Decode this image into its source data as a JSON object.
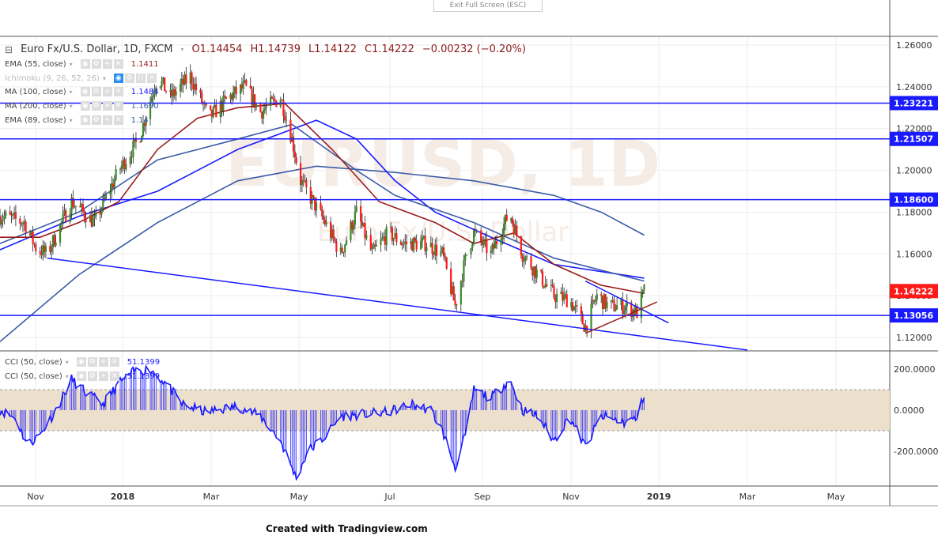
{
  "ui": {
    "exit_fullscreen": "Exit Full Screen (ESC)",
    "footer": "Created with Tradingview.com",
    "watermark": "EURUSD, 1D",
    "watermark2": "Euro Fx/U.S. Dollar"
  },
  "header": {
    "symbol": "Euro Fx/U.S. Dollar, 1D, FXCM",
    "open": "O1.14454",
    "high": "H1.14739",
    "low": "L1.14122",
    "close": "C1.14222",
    "change": "−0.00232 (−0.20%)"
  },
  "indicators": [
    {
      "label": "EMA (55, close)",
      "value": "1.1411",
      "color": "#9b1c1c"
    },
    {
      "label": "Ichimoku (9, 26, 52, 26)",
      "value": "",
      "color": "#bbbbbb"
    },
    {
      "label": "MA (100, close)",
      "value": "1.1484",
      "color": "#1a1aff"
    },
    {
      "label": "MA (200, close)",
      "value": "1.1690",
      "color": "#3a5ba8"
    },
    {
      "label": "EMA (89, close)",
      "value": "1.14",
      "color": "#3a5ba8"
    }
  ],
  "cci_legend": [
    {
      "label": "CCI (50, close)",
      "value": "51.1399"
    },
    {
      "label": "CCI (50, close)",
      "value": "51.1399"
    }
  ],
  "chart_data": [
    {
      "type": "candlestick",
      "title": "Euro Fx/U.S. Dollar, 1D, FXCM",
      "x_unit": "days since 2017-10-20",
      "x_ticks": [
        "Nov",
        "2018",
        "Mar",
        "May",
        "Jul",
        "Sep",
        "Nov",
        "2019",
        "Mar",
        "May"
      ],
      "y_ticks": [
        "1.26000",
        "1.24000",
        "1.22000",
        "1.20000",
        "1.18000",
        "1.16000",
        "1.14000",
        "1.12000"
      ],
      "ylim": [
        1.112,
        1.264
      ],
      "price_path": [
        [
          3,
          1.178
        ],
        [
          17,
          1.175
        ],
        [
          25,
          1.163
        ],
        [
          33,
          1.16
        ],
        [
          50,
          1.185
        ],
        [
          66,
          1.175
        ],
        [
          83,
          1.2
        ],
        [
          97,
          1.215
        ],
        [
          110,
          1.245
        ],
        [
          119,
          1.235
        ],
        [
          133,
          1.245
        ],
        [
          146,
          1.225
        ],
        [
          160,
          1.235
        ],
        [
          171,
          1.24
        ],
        [
          182,
          1.228
        ],
        [
          196,
          1.235
        ],
        [
          204,
          1.215
        ],
        [
          210,
          1.195
        ],
        [
          227,
          1.175
        ],
        [
          238,
          1.16
        ],
        [
          249,
          1.18
        ],
        [
          260,
          1.16
        ],
        [
          271,
          1.17
        ],
        [
          282,
          1.165
        ],
        [
          298,
          1.165
        ],
        [
          309,
          1.16
        ],
        [
          318,
          1.135
        ],
        [
          326,
          1.16
        ],
        [
          331,
          1.17
        ],
        [
          343,
          1.16
        ],
        [
          356,
          1.18
        ],
        [
          365,
          1.16
        ],
        [
          376,
          1.15
        ],
        [
          387,
          1.14
        ],
        [
          398,
          1.138
        ],
        [
          409,
          1.125
        ],
        [
          417,
          1.14
        ],
        [
          425,
          1.135
        ],
        [
          436,
          1.135
        ],
        [
          445,
          1.132
        ],
        [
          450,
          1.1422
        ]
      ],
      "moving_averages": [
        {
          "name": "MA 200",
          "color": "#3a5ba8",
          "points": [
            [
              0,
              1.118
            ],
            [
              55,
              1.15
            ],
            [
              110,
              1.175
            ],
            [
              166,
              1.195
            ],
            [
              221,
              1.202
            ],
            [
              276,
              1.199
            ],
            [
              331,
              1.195
            ],
            [
              387,
              1.188
            ],
            [
              420,
              1.18
            ],
            [
              450,
              1.169
            ]
          ]
        },
        {
          "name": "MA 100",
          "color": "#1a1aff",
          "points": [
            [
              0,
              1.162
            ],
            [
              55,
              1.178
            ],
            [
              110,
              1.19
            ],
            [
              166,
              1.21
            ],
            [
              221,
              1.224
            ],
            [
              249,
              1.215
            ],
            [
              276,
              1.195
            ],
            [
              304,
              1.18
            ],
            [
              343,
              1.168
            ],
            [
              387,
              1.155
            ],
            [
              450,
              1.1484
            ]
          ]
        },
        {
          "name": "EMA 89",
          "color": "#3a5ba8",
          "points": [
            [
              0,
              1.165
            ],
            [
              55,
              1.18
            ],
            [
              110,
              1.205
            ],
            [
              166,
              1.215
            ],
            [
              204,
              1.222
            ],
            [
              249,
              1.2
            ],
            [
              276,
              1.188
            ],
            [
              331,
              1.175
            ],
            [
              387,
              1.158
            ],
            [
              450,
              1.147
            ]
          ]
        },
        {
          "name": "EMA 55",
          "color": "#9b1c1c",
          "points": [
            [
              0,
              1.168
            ],
            [
              28,
              1.168
            ],
            [
              55,
              1.175
            ],
            [
              83,
              1.185
            ],
            [
              110,
              1.21
            ],
            [
              138,
              1.225
            ],
            [
              166,
              1.23
            ],
            [
              199,
              1.232
            ],
            [
              232,
              1.21
            ],
            [
              265,
              1.185
            ],
            [
              304,
              1.175
            ],
            [
              331,
              1.165
            ],
            [
              359,
              1.17
            ],
            [
              387,
              1.155
            ],
            [
              420,
              1.145
            ],
            [
              450,
              1.1411
            ]
          ]
        }
      ],
      "horizontal_levels": [
        {
          "value": 1.23221,
          "label": "1.23221"
        },
        {
          "value": 1.21507,
          "label": "1.21507"
        },
        {
          "value": 1.186,
          "label": "1.18600"
        },
        {
          "value": 1.13056,
          "label": "1.13056"
        }
      ],
      "trendlines": [
        {
          "color": "#1a1aff",
          "from": [
            33,
            1.158
          ],
          "to": [
            522,
            1.114
          ]
        },
        {
          "color": "#1a1aff",
          "from": [
            409,
            1.147
          ],
          "to": [
            467,
            1.127
          ]
        },
        {
          "color": "#9b1c1c",
          "from": [
            409,
            1.122
          ],
          "to": [
            459,
            1.137
          ]
        }
      ],
      "last_price": {
        "value": 1.14222,
        "label": "1.14222"
      }
    },
    {
      "type": "bar",
      "title": "CCI (50, close)",
      "x_unit": "days since 2017-10-20",
      "y_ticks": [
        "200.0000",
        "0.0000",
        "-200.0000"
      ],
      "ylim": [
        -350,
        250
      ],
      "band": [
        -100,
        100
      ],
      "points": [
        [
          0,
          0
        ],
        [
          11,
          -40
        ],
        [
          19,
          -170
        ],
        [
          28,
          -120
        ],
        [
          39,
          0
        ],
        [
          50,
          150
        ],
        [
          61,
          80
        ],
        [
          72,
          30
        ],
        [
          83,
          130
        ],
        [
          94,
          190
        ],
        [
          105,
          200
        ],
        [
          116,
          130
        ],
        [
          127,
          30
        ],
        [
          144,
          -10
        ],
        [
          166,
          20
        ],
        [
          182,
          -30
        ],
        [
          196,
          -150
        ],
        [
          207,
          -330
        ],
        [
          215,
          -200
        ],
        [
          227,
          -130
        ],
        [
          238,
          -30
        ],
        [
          254,
          -20
        ],
        [
          271,
          -10
        ],
        [
          287,
          30
        ],
        [
          301,
          0
        ],
        [
          309,
          -100
        ],
        [
          318,
          -280
        ],
        [
          326,
          -100
        ],
        [
          331,
          100
        ],
        [
          343,
          60
        ],
        [
          356,
          150
        ],
        [
          365,
          0
        ],
        [
          376,
          -30
        ],
        [
          387,
          -150
        ],
        [
          398,
          -30
        ],
        [
          409,
          -180
        ],
        [
          420,
          -30
        ],
        [
          436,
          -60
        ],
        [
          445,
          -40
        ],
        [
          450,
          80
        ]
      ]
    }
  ]
}
